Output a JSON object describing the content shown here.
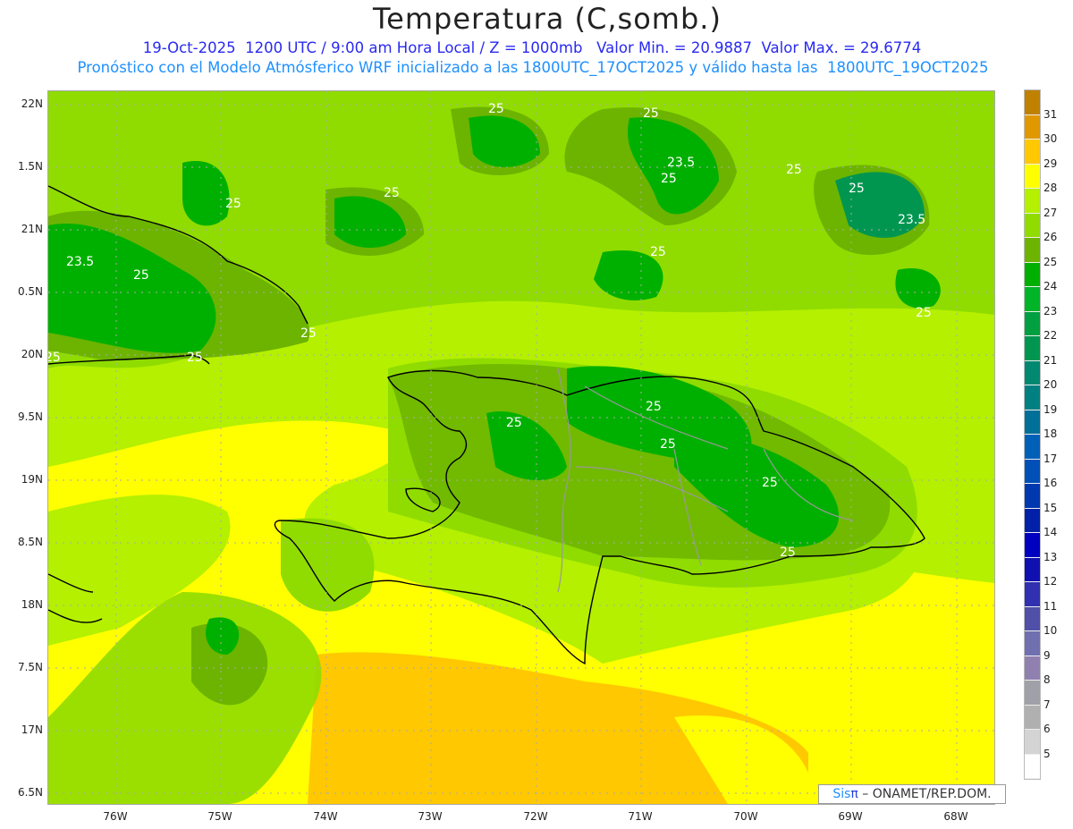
{
  "header": {
    "title": "Temperatura (C,somb.)",
    "line1": "19-Oct-2025  1200 UTC / 9:00 am Hora Local / Z = 1000mb   Valor Min. = 20.9887  Valor Max. = 29.6774",
    "line2": "Pronóstico con el Modelo Atmósferico WRF inicializado a las 1800UTC_17OCT2025 y válido hasta las  1800UTC_19OCT2025"
  },
  "axes": {
    "lat_labels": [
      "22N",
      "1.5N",
      "21N",
      "0.5N",
      "20N",
      "9.5N",
      "19N",
      "8.5N",
      "18N",
      "7.5N",
      "17N",
      "6.5N"
    ],
    "lon_labels": [
      "76W",
      "75W",
      "74W",
      "73W",
      "72W",
      "71W",
      "70W",
      "69W",
      "68W"
    ]
  },
  "colorbar": {
    "labels": [
      "31",
      "30",
      "29",
      "28",
      "27",
      "26",
      "25",
      "24",
      "23",
      "22",
      "21",
      "20",
      "19",
      "18",
      "17",
      "16",
      "15",
      "14",
      "13",
      "12",
      "11",
      "10",
      "9",
      "8",
      "7",
      "6",
      "5"
    ],
    "colors": [
      "#c08000",
      "#e09800",
      "#ffc800",
      "#ffff00",
      "#b4f000",
      "#90dc00",
      "#6cb400",
      "#00b000",
      "#00b428",
      "#00a040",
      "#009650",
      "#008870",
      "#008080",
      "#007098",
      "#0060b8",
      "#0050b8",
      "#0038b0",
      "#0020a8",
      "#0000c0",
      "#1010b0",
      "#3030b0",
      "#5050a8",
      "#7070b0",
      "#9080b0",
      "#a0a0a8",
      "#b0b0b0",
      "#d4d4d4",
      "#ffffff"
    ]
  },
  "contours": [
    "25",
    "25",
    "25",
    "23.5",
    "25",
    "25",
    "25",
    "25",
    "23.5",
    "25",
    "23.5",
    "25",
    "25",
    "25",
    "25",
    "25",
    "25",
    "25",
    "25",
    "25",
    "25"
  ],
  "logo": {
    "sis": "Sis",
    "pi": "π",
    "rest": " – ONAMET/REP.DOM."
  }
}
